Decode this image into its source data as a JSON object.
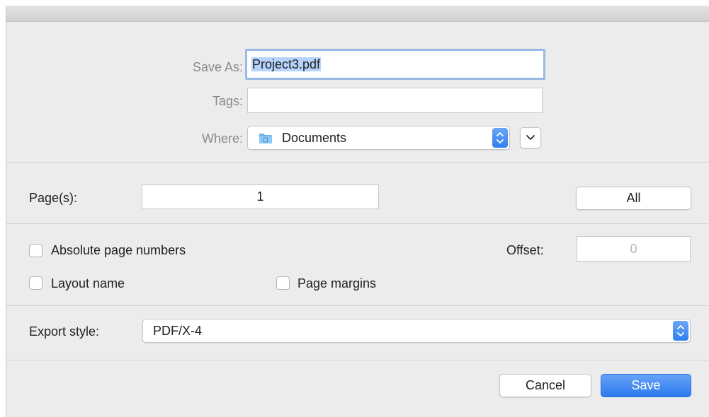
{
  "save_as": {
    "label": "Save As:",
    "value": "Project3.pdf"
  },
  "tags": {
    "label": "Tags:",
    "value": ""
  },
  "where": {
    "label": "Where:",
    "value": "Documents",
    "icon": "folder-icon"
  },
  "pages": {
    "label": "Page(s):",
    "value": "1",
    "all_label": "All"
  },
  "options": {
    "absolute_page_numbers": {
      "label": "Absolute page numbers",
      "checked": false
    },
    "layout_name": {
      "label": "Layout name",
      "checked": false
    },
    "page_margins": {
      "label": "Page margins",
      "checked": false
    },
    "offset_label": "Offset:",
    "offset_placeholder": "0"
  },
  "export_style": {
    "label": "Export style:",
    "value": "PDF/X-4"
  },
  "buttons": {
    "cancel": "Cancel",
    "save": "Save"
  },
  "colors": {
    "accent": "#2f7ff0",
    "selection": "#b5d3fb",
    "focus_ring": "#9ab9e6"
  }
}
